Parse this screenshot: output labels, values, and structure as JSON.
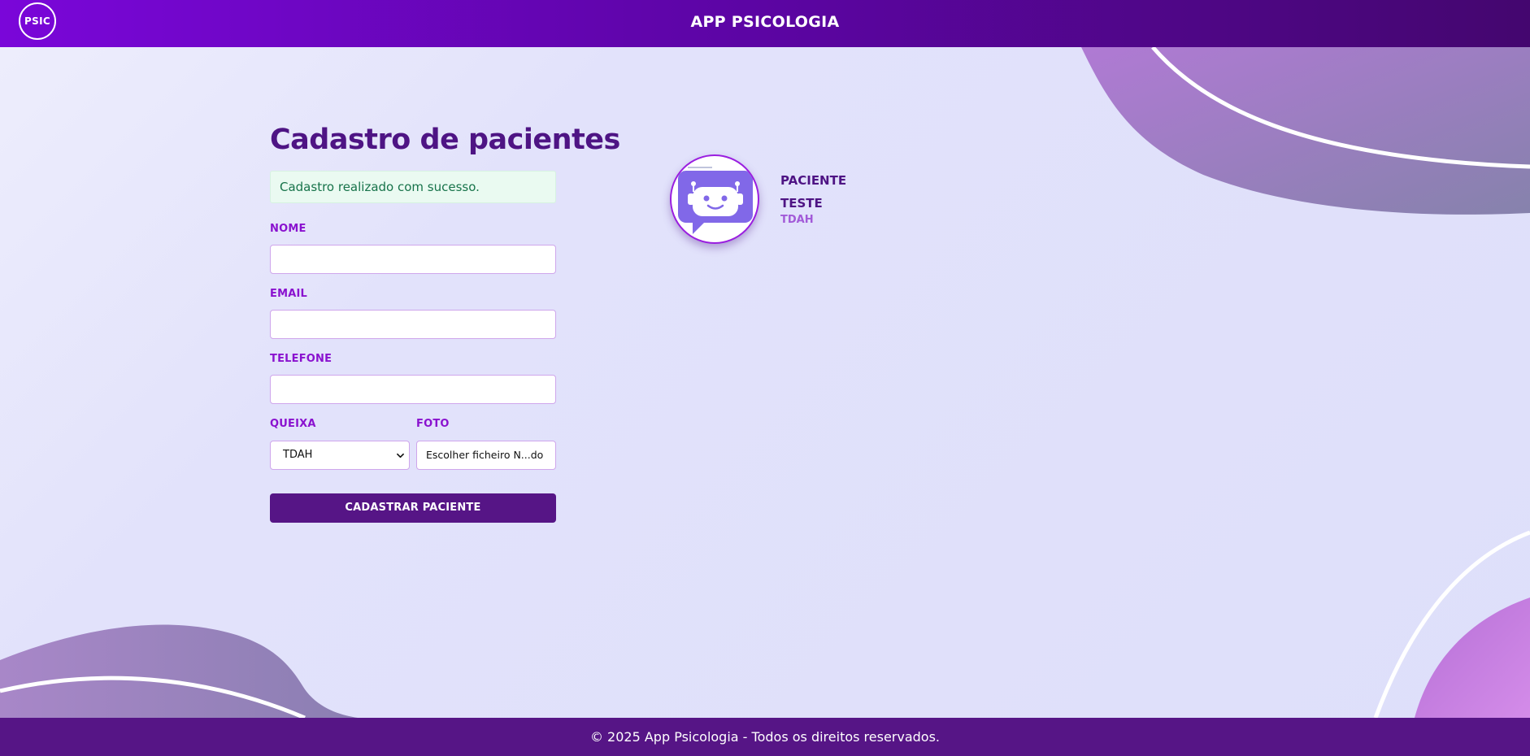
{
  "colors": {
    "header_start": "#7a06d9",
    "header_end": "#44066f",
    "primary_dark": "#561586",
    "title": "#4e1484",
    "label": "#8a12cf",
    "success_bg": "#eafaf1",
    "success_text": "#17734a",
    "avatar_bot": "#8168e8"
  },
  "header": {
    "logo_text": "PSIC",
    "app_title": "APP PSICOLOGIA"
  },
  "form": {
    "title": "Cadastro de pacientes",
    "success_message": "Cadastro realizado com sucesso.",
    "fields": {
      "nome": {
        "label": "NOME",
        "value": ""
      },
      "email": {
        "label": "EMAIL",
        "value": ""
      },
      "telefone": {
        "label": "TELEFONE",
        "value": ""
      }
    },
    "queixa": {
      "label": "QUEIXA",
      "selected": "TDAH"
    },
    "foto": {
      "label": "FOTO",
      "button_text": "Escolher ficheiro N...do"
    },
    "submit_label": "CADASTRAR PACIENTE"
  },
  "patient": {
    "name": "PACIENTE TESTE",
    "complaint": "TDAH",
    "avatar_icon": "robot-chat-icon"
  },
  "footer": {
    "text": "© 2025 App Psicologia - Todos os direitos reservados."
  }
}
